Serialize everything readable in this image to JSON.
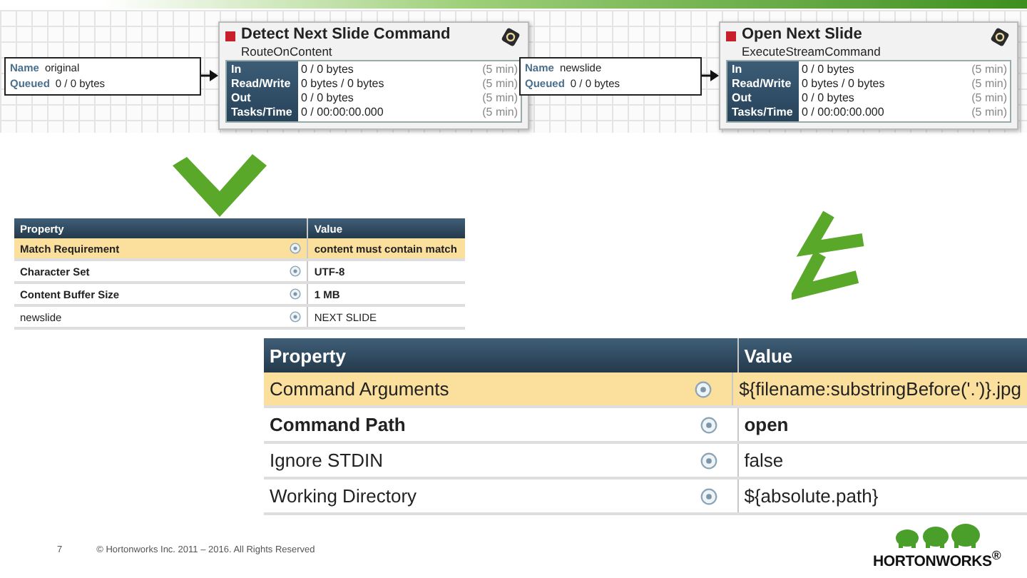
{
  "flow": [
    {
      "connection": {
        "name_label": "Name",
        "name": "original",
        "queued_label": "Queued",
        "queued": "0 / 0 bytes"
      },
      "processor": {
        "name": "Detect Next Slide Command",
        "type": "RouteOnContent",
        "running": false,
        "stats": [
          {
            "label": "In",
            "value": "0 / 0 bytes",
            "window": "(5 min)"
          },
          {
            "label": "Read/Write",
            "value": "0 bytes / 0 bytes",
            "window": "(5 min)"
          },
          {
            "label": "Out",
            "value": "0 / 0 bytes",
            "window": "(5 min)"
          },
          {
            "label": "Tasks/Time",
            "value": "0 / 00:00:00.000",
            "window": "(5 min)"
          }
        ]
      }
    },
    {
      "connection": {
        "name_label": "Name",
        "name": "newslide",
        "queued_label": "Queued",
        "queued": "0 / 0 bytes"
      },
      "processor": {
        "name": "Open Next Slide",
        "type": "ExecuteStreamCommand",
        "running": false,
        "stats": [
          {
            "label": "In",
            "value": "0 / 0 bytes",
            "window": "(5 min)"
          },
          {
            "label": "Read/Write",
            "value": "0 bytes / 0 bytes",
            "window": "(5 min)"
          },
          {
            "label": "Out",
            "value": "0 / 0 bytes",
            "window": "(5 min)"
          },
          {
            "label": "Tasks/Time",
            "value": "0 / 00:00:00.000",
            "window": "(5 min)"
          }
        ]
      }
    }
  ],
  "tables": [
    {
      "columns": [
        "Property",
        "Value"
      ],
      "rows": [
        {
          "property": "Match Requirement",
          "value": "content must contain match",
          "selected": true,
          "required": true
        },
        {
          "property": "Character Set",
          "value": "UTF-8",
          "selected": false,
          "required": true
        },
        {
          "property": "Content Buffer Size",
          "value": "1 MB",
          "selected": false,
          "required": true
        },
        {
          "property": "newslide",
          "value": "NEXT SLIDE",
          "selected": false,
          "required": false
        }
      ]
    },
    {
      "columns": [
        "Property",
        "Value"
      ],
      "rows": [
        {
          "property": "Command Arguments",
          "value": "${filename:substringBefore('.')}.jpg",
          "selected": true,
          "required": false
        },
        {
          "property": "Command Path",
          "value": "open",
          "selected": false,
          "required": true
        },
        {
          "property": "Ignore STDIN",
          "value": "false",
          "selected": false,
          "required": false
        },
        {
          "property": "Working Directory",
          "value": "${absolute.path}",
          "selected": false,
          "required": false
        }
      ]
    }
  ],
  "footer": {
    "page": "7",
    "copyright": "© Hortonworks Inc. 2011 – 2016. All Rights Reserved",
    "logo": "HORTONWORKS$^{®}$"
  }
}
